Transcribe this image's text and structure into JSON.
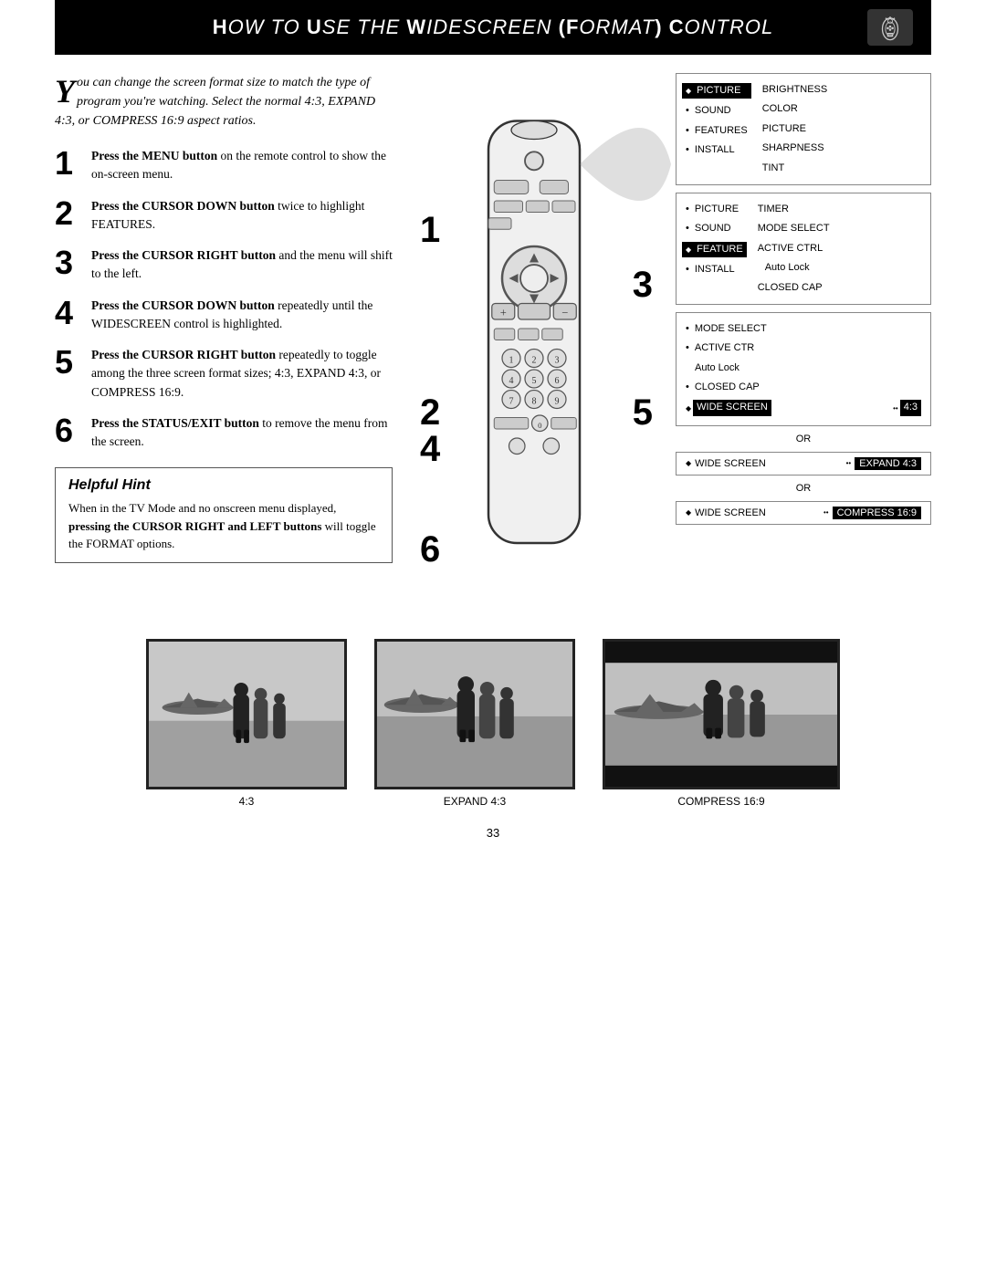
{
  "header": {
    "title": "How to Use the Widescreen (Format) Control"
  },
  "intro": {
    "drop_cap": "Y",
    "text": "ou can change the screen format size to match the type of program you're watching. Select the normal 4:3, EXPAND 4:3, or COMPRESS 16:9 aspect ratios."
  },
  "steps": [
    {
      "number": "1",
      "bold": "Press the MENU button",
      "rest": " on the remote control to show the on-screen menu."
    },
    {
      "number": "2",
      "bold": "Press the CURSOR DOWN button",
      "rest": " twice to highlight FEATURES."
    },
    {
      "number": "3",
      "bold": "Press the CURSOR RIGHT button",
      "rest": " and the menu will shift to the left."
    },
    {
      "number": "4",
      "bold": "Press the CURSOR DOWN button",
      "rest": " repeatedly until the WIDESCREEN control is highlighted."
    },
    {
      "number": "5",
      "bold": "Press the CURSOR RIGHT button",
      "rest": " repeatedly to toggle among the three screen format sizes; 4:3, EXPAND 4:3, or COMPRESS 16:9."
    },
    {
      "number": "6",
      "bold": "Press the STATUS/EXIT button",
      "rest": " to remove the menu from the screen."
    }
  ],
  "hint": {
    "title": "Helpful Hint",
    "text": "When in the TV Mode and no onscreen menu displayed, pressing the CURSOR RIGHT and LEFT buttons will toggle the FORMAT options."
  },
  "menu1": {
    "items_left": [
      "PICTURE",
      "SOUND",
      "FEATURES",
      "INSTALL"
    ],
    "items_right": [
      "BRIGHTNESS",
      "COLOR",
      "PICTURE",
      "SHARPNESS",
      "TINT"
    ]
  },
  "menu2": {
    "items": [
      "PICTURE",
      "SOUND",
      "FEATURE",
      "INSTALL"
    ],
    "items_right": [
      "TIMER",
      "MODE SELECT",
      "ACTIVE CTRL",
      "Auto Lock",
      "CLOSED CAP"
    ]
  },
  "menu3": {
    "items": [
      "MODE SELECT",
      "ACTIVE CTR",
      "Auto Lock",
      "CLOSED CAP",
      "WIDE SCREEN"
    ],
    "ws_value": "4:3"
  },
  "ws_options": [
    {
      "label": "WIDE SCREEN",
      "value": "EXPAND 4:3",
      "or_before": true
    },
    {
      "label": "WIDE SCREEN",
      "value": "COMPRESS 16:9",
      "or_before": true
    }
  ],
  "formats": [
    {
      "label": "4:3",
      "type": "normal"
    },
    {
      "label": "EXPAND 4:3",
      "type": "expand"
    },
    {
      "label": "COMPRESS 16:9",
      "type": "compress"
    }
  ],
  "page_number": "33"
}
